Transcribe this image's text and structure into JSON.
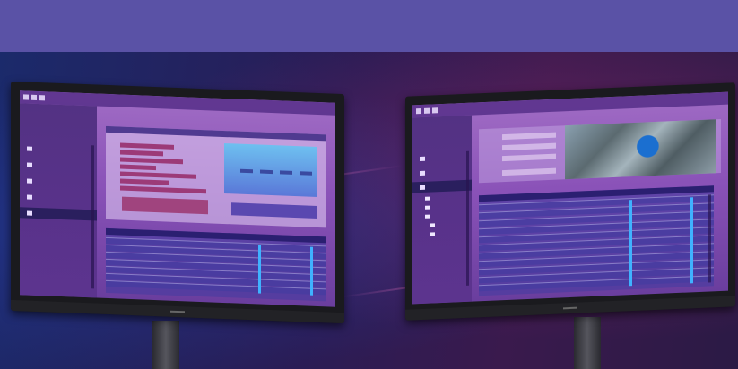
{
  "colors": {
    "banner": "#5a52a6",
    "accent_cyan": "#3fb2ff",
    "active_nav": "#2a1f5e"
  },
  "left_monitor": {
    "app_title": "",
    "app_subtitle": "",
    "window_title": "",
    "nav": [
      {
        "icon": "home-icon",
        "label": ""
      },
      {
        "icon": "folder-icon",
        "label": ""
      },
      {
        "icon": "document-icon",
        "label": ""
      },
      {
        "icon": "list-icon",
        "label": ""
      },
      {
        "icon": "settings-icon",
        "label": ""
      }
    ]
  },
  "right_monitor": {
    "app_title": "",
    "app_subtitle": "",
    "window_title": "",
    "fields": [
      {
        "label": ""
      },
      {
        "label": ""
      },
      {
        "label": ""
      },
      {
        "label": ""
      }
    ],
    "tree": [
      {
        "label": ""
      },
      {
        "label": ""
      },
      {
        "label": ""
      },
      {
        "label": ""
      },
      {
        "label": ""
      }
    ]
  }
}
